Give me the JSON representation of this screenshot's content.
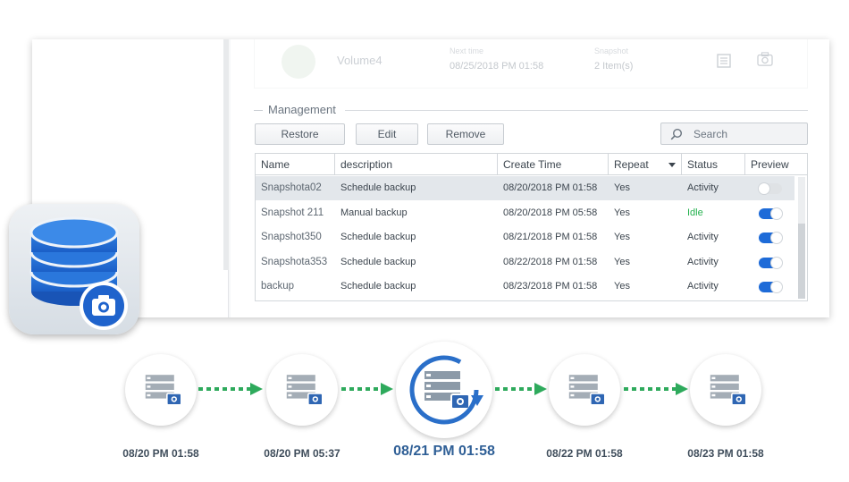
{
  "volume_row": {
    "name": "Volume4",
    "time_label": "Next time",
    "time_value": "08/25/2018 PM 01:58",
    "items_label": "Snapshot",
    "items_value": "2 Item(s)"
  },
  "section_title": "Management",
  "buttons": {
    "restore": "Restore",
    "edit": "Edit",
    "remove": "Remove"
  },
  "search": {
    "placeholder": "Search"
  },
  "table": {
    "headers": [
      "Name",
      "description",
      "Create Time",
      "Repeat",
      "Status",
      "Preview"
    ],
    "rows": [
      {
        "name": "Snapshota02",
        "description": "Schedule backup",
        "create_time": "08/20/2018 PM 01:58",
        "repeat": "Yes",
        "status": "Activity",
        "preview": false,
        "selected": true
      },
      {
        "name": "Snapshot 211",
        "description": "Manual backup",
        "create_time": "08/20/2018 PM 05:58",
        "repeat": "Yes",
        "status": "Idle",
        "preview": true,
        "selected": false
      },
      {
        "name": "Snapshot350",
        "description": "Schedule backup",
        "create_time": "08/21/2018 PM 01:58",
        "repeat": "Yes",
        "status": "Activity",
        "preview": true,
        "selected": false
      },
      {
        "name": "Snapshota353",
        "description": "Schedule backup",
        "create_time": "08/22/2018 PM 01:58",
        "repeat": "Yes",
        "status": "Activity",
        "preview": true,
        "selected": false
      },
      {
        "name": "backup",
        "description": "Schedule backup",
        "create_time": "08/23/2018 PM 01:58",
        "repeat": "Yes",
        "status": "Activity",
        "preview": true,
        "selected": false
      }
    ]
  },
  "timeline": [
    {
      "label": "08/20 PM 01:58",
      "active": false
    },
    {
      "label": "08/20 PM 05:37",
      "active": false
    },
    {
      "label": "08/21 PM 01:58",
      "active": true
    },
    {
      "label": "08/22 PM 01:58",
      "active": false
    },
    {
      "label": "08/23 PM 01:58",
      "active": false
    }
  ],
  "colors": {
    "accent": "#1e6bd8",
    "idle": "#23b14d",
    "arrow": "#2eaa5c",
    "timeline_label": "#3f4d5b",
    "timeline_active": "#2f5f96"
  },
  "icons": {
    "app": "database-camera-icon",
    "timeline": "server-camera-icon",
    "search": "search-icon"
  }
}
